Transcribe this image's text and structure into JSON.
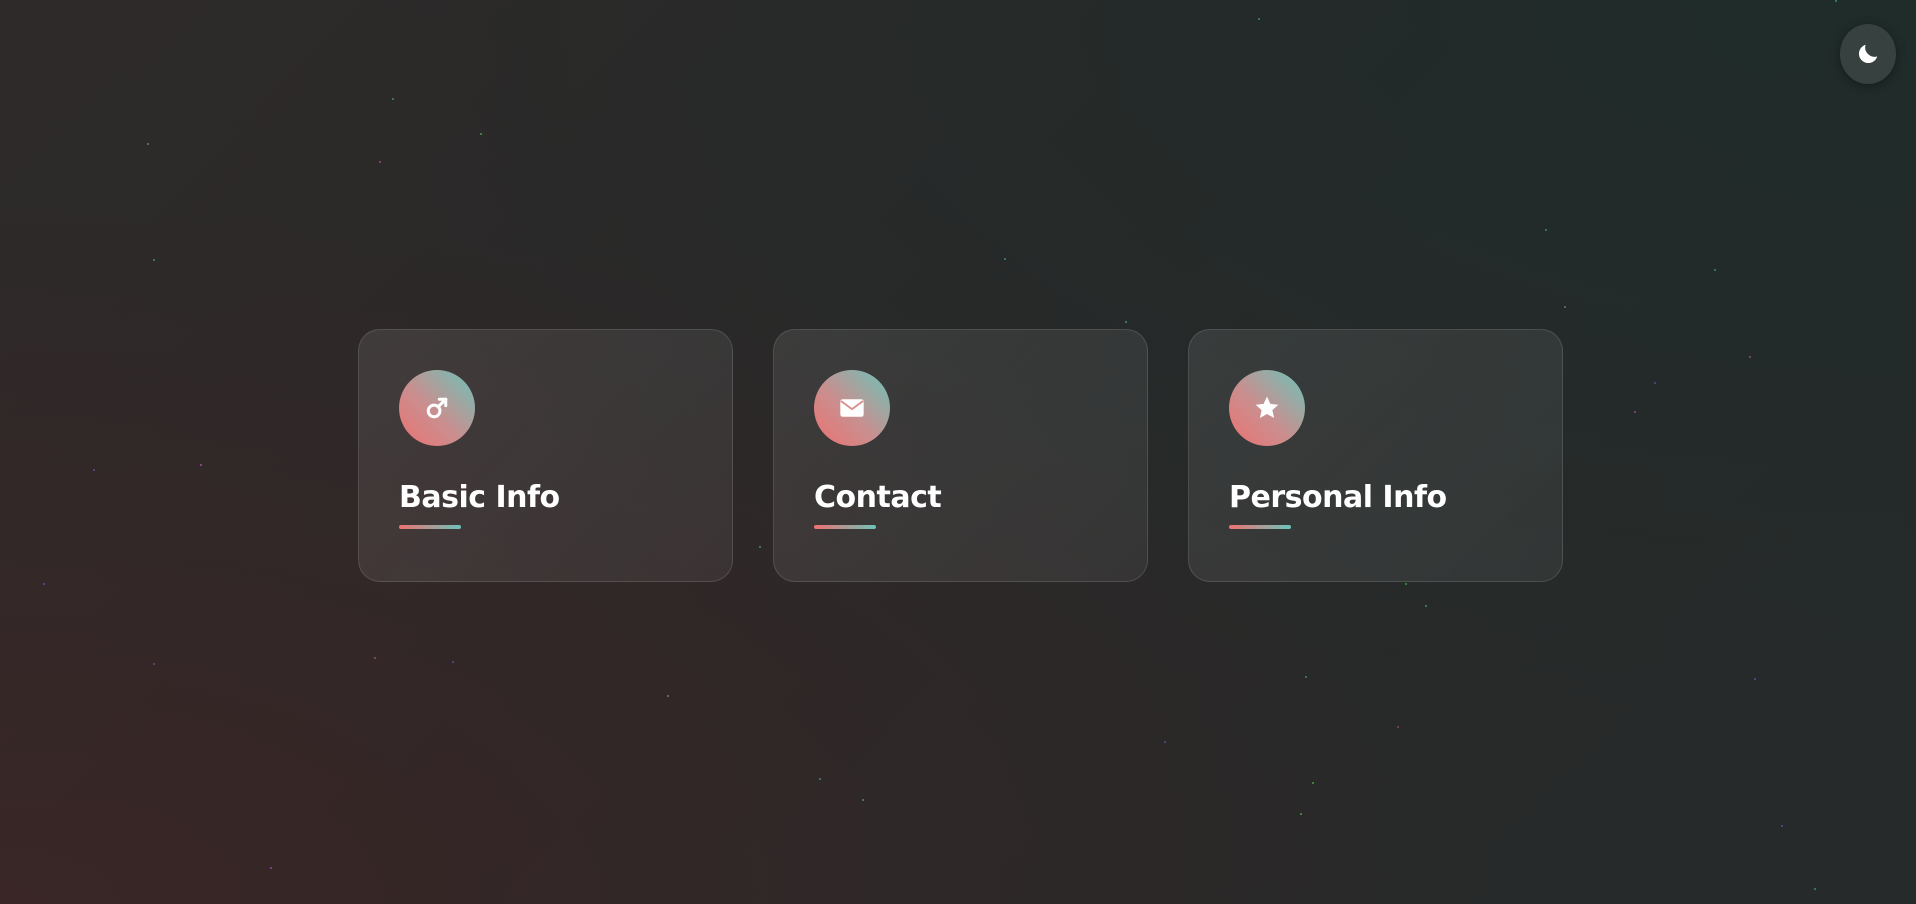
{
  "theme_toggle": {
    "icon": "moon-icon"
  },
  "cards": [
    {
      "title": "Basic Info",
      "icon": "male-symbol-icon"
    },
    {
      "title": "Contact",
      "icon": "envelope-icon"
    },
    {
      "title": "Personal Info",
      "icon": "star-icon"
    }
  ],
  "colors": {
    "accent_start": "#ee7171",
    "accent_end": "#6cc3b9",
    "background": "#2a2828",
    "text": "#ffffff"
  }
}
